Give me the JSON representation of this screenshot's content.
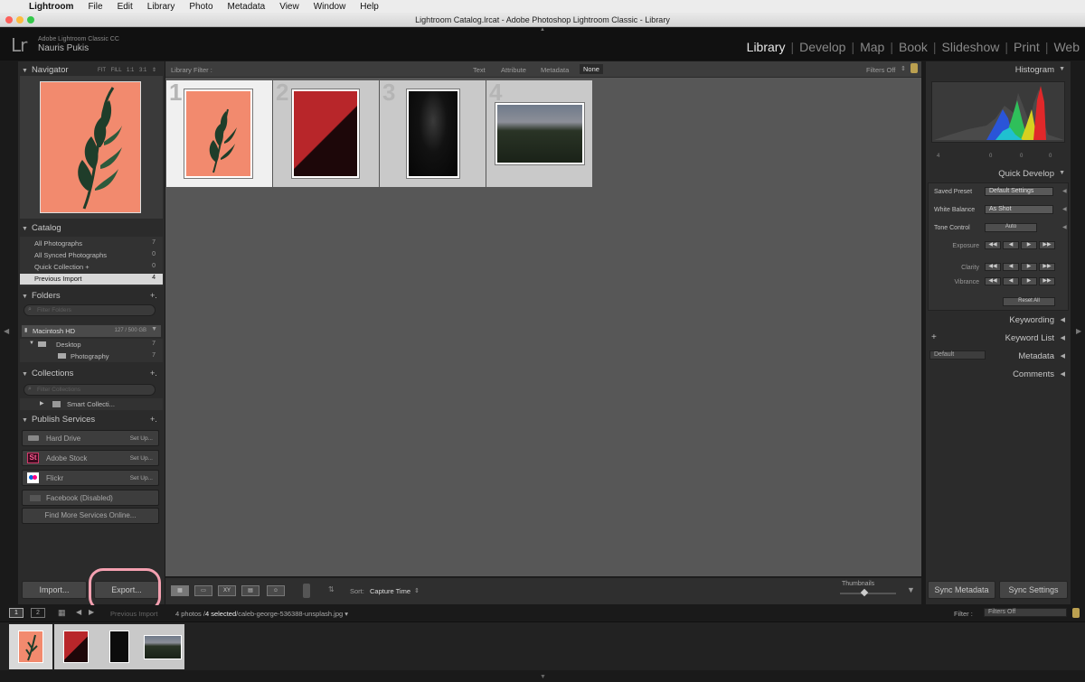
{
  "menubar": {
    "items": [
      "Lightroom",
      "File",
      "Edit",
      "Library",
      "Photo",
      "Metadata",
      "View",
      "Window",
      "Help"
    ]
  },
  "titlebar": {
    "title": "Lightroom Catalog.lrcat - Adobe Photoshop Lightroom Classic - Library"
  },
  "header": {
    "logo": "Lr",
    "app_name": "Adobe Lightroom Classic CC",
    "user_name": "Nauris Pukis",
    "modules": [
      "Library",
      "Develop",
      "Map",
      "Book",
      "Slideshow",
      "Print",
      "Web"
    ],
    "active_module": "Library"
  },
  "navigator": {
    "title": "Navigator",
    "zoom": [
      "FIT",
      "FILL",
      "1:1",
      "3:1"
    ]
  },
  "catalog": {
    "title": "Catalog",
    "items": [
      {
        "label": "All Photographs",
        "count": "7"
      },
      {
        "label": "All Synced Photographs",
        "count": "0"
      },
      {
        "label": "Quick Collection +",
        "count": "0"
      },
      {
        "label": "Previous Import",
        "count": "4"
      }
    ]
  },
  "folders": {
    "title": "Folders",
    "add": "+.",
    "filter_placeholder": "Filter Folders",
    "volume": {
      "name": "Macintosh HD",
      "size": "127 / 500 GB"
    },
    "items": [
      {
        "label": "Desktop",
        "count": "7"
      },
      {
        "label": "Photography",
        "count": "7"
      }
    ]
  },
  "collections": {
    "title": "Collections",
    "add": "+.",
    "filter_placeholder": "Filter Collections",
    "items": [
      {
        "label": "Smart Collecti..."
      }
    ]
  },
  "publish": {
    "title": "Publish Services",
    "add": "+.",
    "services": [
      {
        "label": "Hard Drive",
        "action": "Set Up...",
        "icon": "hard-drive-icon"
      },
      {
        "label": "Adobe Stock",
        "action": "Set Up...",
        "icon": "adobe-stock-icon",
        "badge": "St"
      },
      {
        "label": "Flickr",
        "action": "Set Up...",
        "icon": "flickr-icon"
      },
      {
        "label": "Facebook (Disabled)",
        "action": "",
        "icon": "facebook-icon"
      }
    ],
    "find_more": "Find More Services Online..."
  },
  "left_buttons": {
    "import": "Import...",
    "export": "Export..."
  },
  "library_filter": {
    "label": "Library Filter :",
    "tabs": [
      "Text",
      "Attribute",
      "Metadata",
      "None"
    ],
    "active_tab": "None",
    "filters": "Filters Off"
  },
  "grid": {
    "cells": [
      {
        "number": "1",
        "selected": true
      },
      {
        "number": "2",
        "selected": false
      },
      {
        "number": "3",
        "selected": false
      },
      {
        "number": "4",
        "selected": false
      }
    ]
  },
  "toolbar": {
    "sort_label": "Sort:",
    "sort_value": "Capture Time",
    "thumbnails_label": "Thumbnails"
  },
  "right_buttons": {
    "sync_metadata": "Sync Metadata",
    "sync_settings": "Sync Settings"
  },
  "histogram": {
    "title": "Histogram",
    "counts": [
      "4",
      "0",
      "0",
      "0"
    ]
  },
  "quick_develop": {
    "title": "Quick Develop",
    "saved_preset_label": "Saved Preset",
    "saved_preset_value": "Default Settings",
    "white_balance_label": "White Balance",
    "white_balance_value": "As Shot",
    "tone_control_label": "Tone Control",
    "auto": "Auto",
    "exposure": "Exposure",
    "clarity": "Clarity",
    "vibrance": "Vibrance",
    "reset_all": "Reset All"
  },
  "keywording": {
    "title": "Keywording"
  },
  "keyword_list": {
    "title": "Keyword List",
    "add": "+"
  },
  "metadata": {
    "title": "Metadata",
    "preset": "Default"
  },
  "comments": {
    "title": "Comments"
  },
  "filmstrip": {
    "pages": [
      "1",
      "2"
    ],
    "source": "Previous Import",
    "info_count": "4 photos /",
    "info_selected": "4 selected",
    "info_file": "/caleb-george-536388-unsplash.jpg",
    "filter_label": "Filter :",
    "filter_value": "Filters Off"
  },
  "colors": {
    "accent_export_highlight": "#f4a0b0",
    "thumb_peach": "#f28a6e",
    "thumb_red": "#b8262a"
  }
}
